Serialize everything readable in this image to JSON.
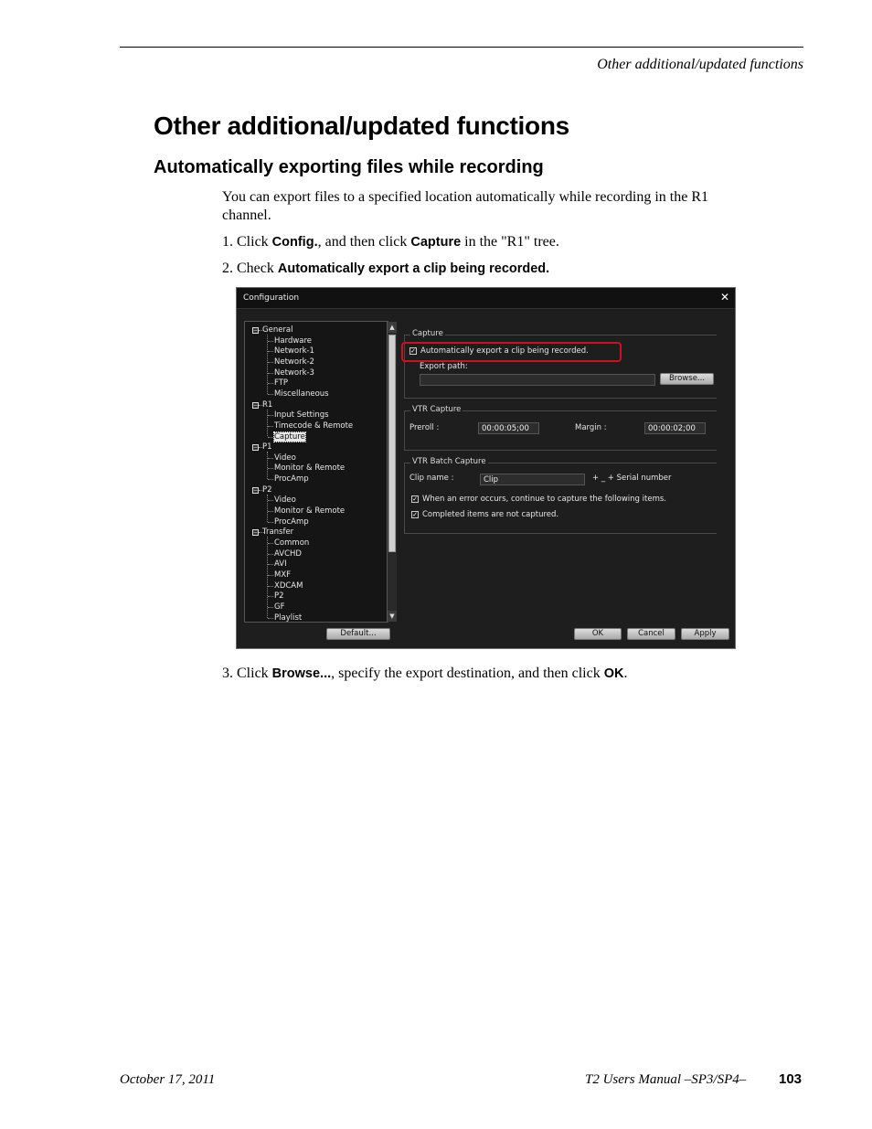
{
  "header": {
    "running_head": "Other additional/updated functions"
  },
  "title": "Other additional/updated functions",
  "section": {
    "heading": "Automatically exporting files while recording",
    "intro_line1": "You can export files to a specified location automatically while recording in the R1",
    "intro_line2": "channel.",
    "step1": {
      "prefix": "1. Click ",
      "b1": "Config.",
      "mid": ", and then click ",
      "b2": "Capture",
      "suffix": " in the \"R1\" tree."
    },
    "step2": {
      "prefix": "2. Check ",
      "b1": "Automatically export a clip being recorded."
    },
    "step3": {
      "prefix": "3. Click ",
      "b1": "Browse...",
      "mid": ", specify the export destination, and then click ",
      "b2": "OK",
      "suffix": "."
    }
  },
  "dialog": {
    "title": "Configuration",
    "close": "✕",
    "tree": [
      {
        "label": "General",
        "level": 0
      },
      {
        "label": "Hardware",
        "level": 1
      },
      {
        "label": "Network-1",
        "level": 1
      },
      {
        "label": "Network-2",
        "level": 1
      },
      {
        "label": "Network-3",
        "level": 1
      },
      {
        "label": "FTP",
        "level": 1
      },
      {
        "label": "Miscellaneous",
        "level": 1
      },
      {
        "label": "R1",
        "level": 0
      },
      {
        "label": "Input Settings",
        "level": 1
      },
      {
        "label": "Timecode & Remote",
        "level": 1
      },
      {
        "label": "Capture",
        "level": 1,
        "selected": true
      },
      {
        "label": "P1",
        "level": 0
      },
      {
        "label": "Video",
        "level": 1
      },
      {
        "label": "Monitor & Remote",
        "level": 1
      },
      {
        "label": "ProcAmp",
        "level": 1
      },
      {
        "label": "P2",
        "level": 0
      },
      {
        "label": "Video",
        "level": 1
      },
      {
        "label": "Monitor & Remote",
        "level": 1
      },
      {
        "label": "ProcAmp",
        "level": 1
      },
      {
        "label": "Transfer",
        "level": 0
      },
      {
        "label": "Common",
        "level": 1
      },
      {
        "label": "AVCHD",
        "level": 1
      },
      {
        "label": "AVI",
        "level": 1
      },
      {
        "label": "MXF",
        "level": 1
      },
      {
        "label": "XDCAM",
        "level": 1
      },
      {
        "label": "P2",
        "level": 1
      },
      {
        "label": "GF",
        "level": 1
      },
      {
        "label": "Playlist",
        "level": 1
      }
    ],
    "capture": {
      "group": "Capture",
      "auto_export": "Automatically export a clip being recorded.",
      "export_path_label": "Export path:",
      "export_path_value": "",
      "browse": "Browse..."
    },
    "vtr_capture": {
      "group": "VTR Capture",
      "preroll_label": "Preroll :",
      "preroll_value": "00:00:05;00",
      "margin_label": "Margin :",
      "margin_value": "00:00:02;00"
    },
    "vtr_batch": {
      "group": "VTR Batch Capture",
      "clip_name_label": "Clip name :",
      "clip_name_value": "Clip",
      "serial_suffix": "+ _ + Serial number",
      "continue_on_error": "When an error occurs, continue to capture the following items.",
      "completed_not_captured": "Completed items are not captured."
    },
    "buttons": {
      "default": "Default...",
      "ok": "OK",
      "cancel": "Cancel",
      "apply": "Apply"
    },
    "highlight_color": "#d0111d"
  },
  "footer": {
    "date": "October 17, 2011",
    "manual": "T2 Users Manual –SP3/SP4–",
    "page": "103"
  }
}
